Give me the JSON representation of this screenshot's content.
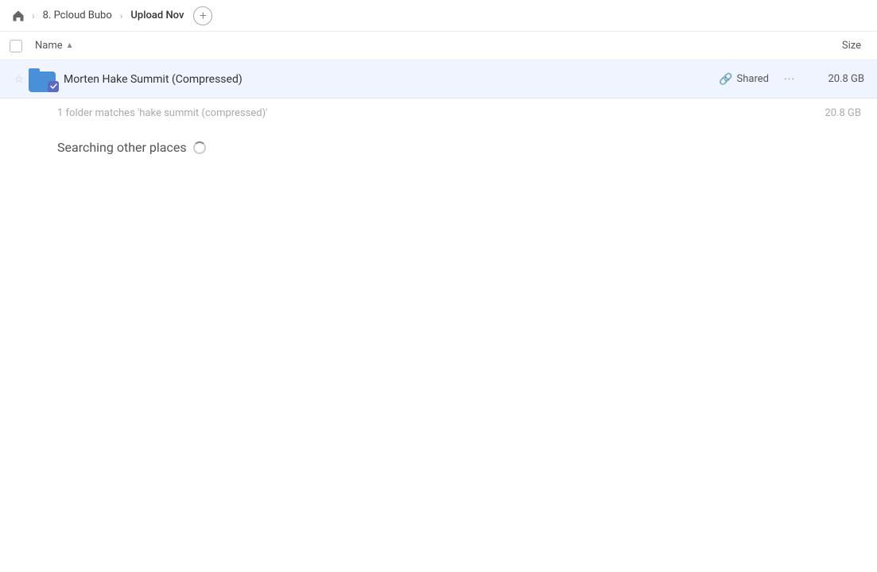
{
  "breadcrumb": {
    "home_icon": "🏠",
    "items": [
      {
        "label": "8. Pcloud Bubo",
        "active": false
      },
      {
        "label": "Upload Nov",
        "active": true
      }
    ],
    "add_label": "+"
  },
  "columns": {
    "checkbox_label": "",
    "name_label": "Name",
    "sort_icon": "▲",
    "size_label": "Size"
  },
  "file_row": {
    "name": "Morten Hake Summit (Compressed)",
    "shared_label": "Shared",
    "size": "20.8 GB",
    "more_icon": "···"
  },
  "summary": {
    "text": "1 folder matches 'hake summit (compressed)'",
    "size": "20.8 GB"
  },
  "searching": {
    "label": "Searching other places"
  }
}
